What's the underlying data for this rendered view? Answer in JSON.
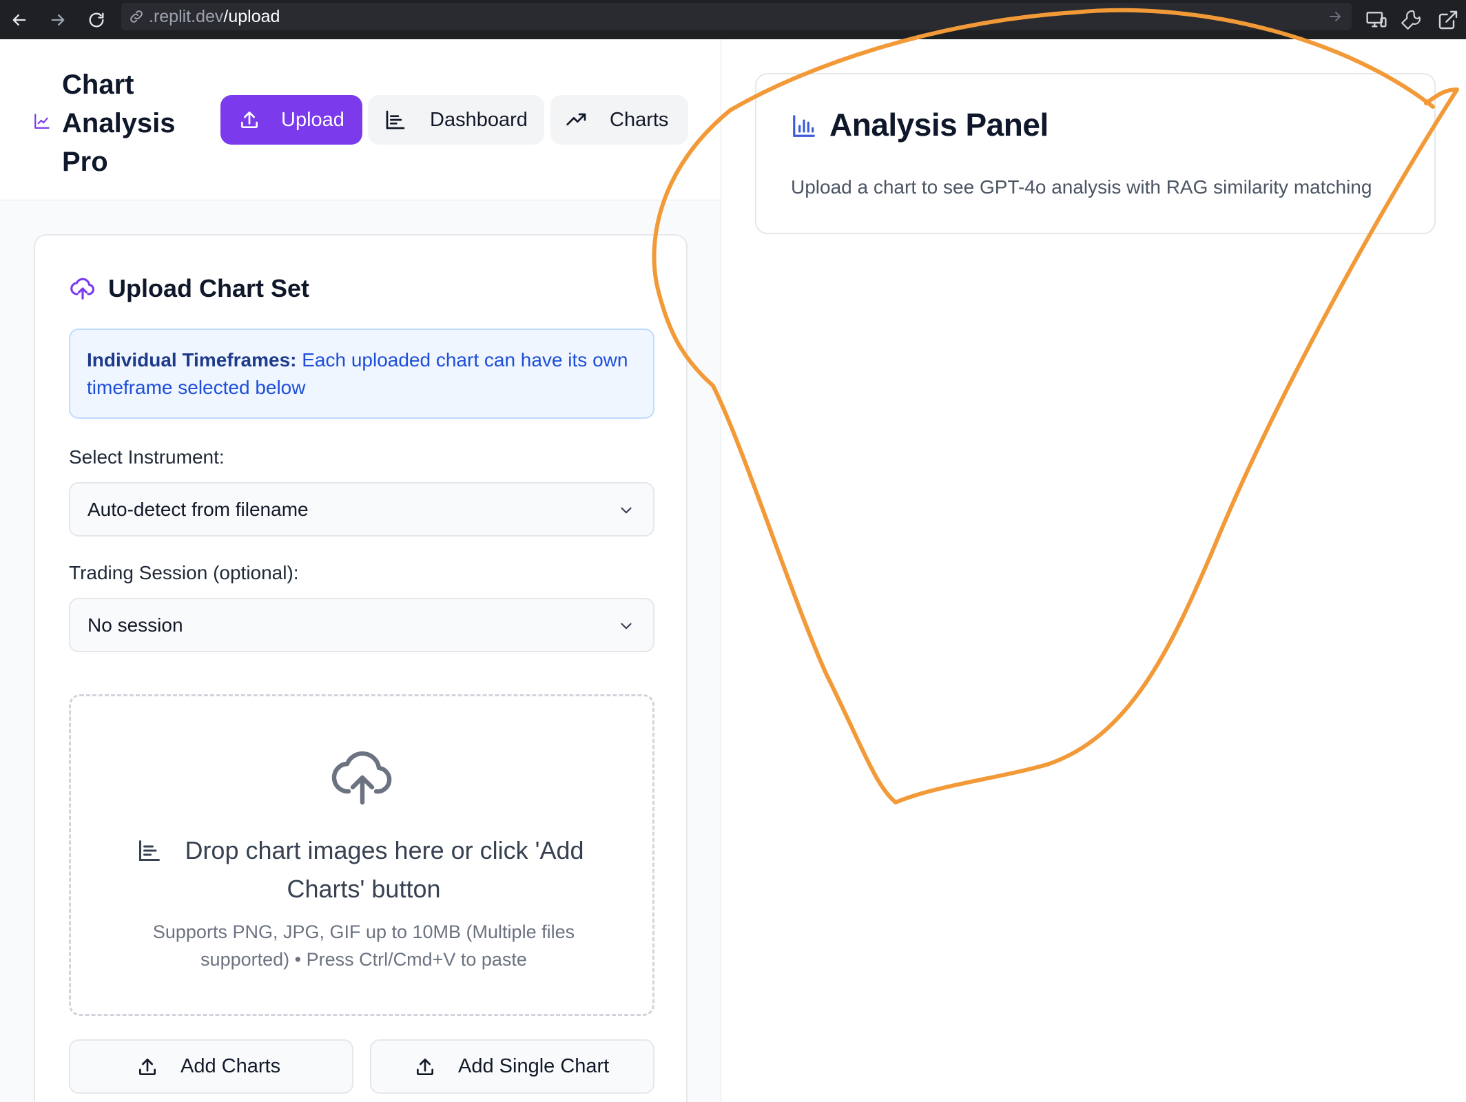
{
  "browser": {
    "url_host": ".replit.dev",
    "url_path": "/upload"
  },
  "app": {
    "title": "Chart Analysis Pro"
  },
  "nav": {
    "tabs": [
      {
        "label": "Upload",
        "active": true
      },
      {
        "label": "Dashboard",
        "active": false
      },
      {
        "label": "Charts",
        "active": false
      }
    ]
  },
  "upload_card": {
    "title": "Upload Chart Set",
    "info_bold": "Individual Timeframes:",
    "info_text": " Each uploaded chart can have its own timeframe selected below",
    "instrument_label": "Select Instrument:",
    "instrument_value": "Auto-detect from filename",
    "session_label": "Trading Session (optional):",
    "session_value": "No session",
    "drop_title": "Drop chart images here or click 'Add Charts' button",
    "drop_sub": "Supports PNG, JPG, GIF up to 10MB (Multiple files supported) • Press Ctrl/Cmd+V to paste",
    "add_charts_label": "Add Charts",
    "add_single_label": "Add Single Chart"
  },
  "analysis_panel": {
    "title": "Analysis Panel",
    "subtitle": "Upload a chart to see GPT-4o analysis with RAG similarity matching"
  },
  "colors": {
    "accent": "#7c3aed",
    "info_bg": "#eff6ff",
    "annotation": "#f29a38"
  }
}
